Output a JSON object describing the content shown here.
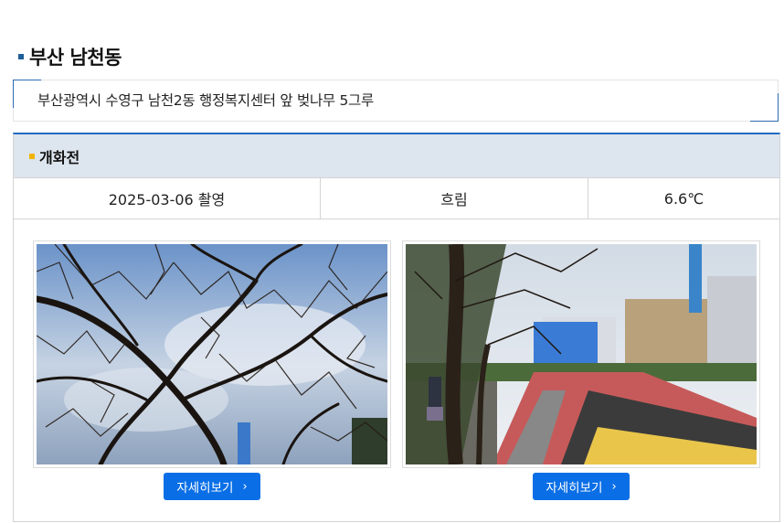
{
  "page": {
    "title": "부산 남천동",
    "address": "부산광역시 수영구 남천2동 행정복지센터 앞 벚나무 5그루"
  },
  "section": {
    "heading": "개화전",
    "date_taken": "2025-03-06 촬영",
    "weather": "흐림",
    "temperature": "6.6℃"
  },
  "photos": [
    {
      "button_label": "자세히보기",
      "button_icon": "chevron-right-icon"
    },
    {
      "button_label": "자세히보기",
      "button_icon": "chevron-right-icon"
    }
  ],
  "colors": {
    "accent_blue": "#0a6fe6",
    "section_border": "#1f6cc2",
    "section_header_bg": "#dde5ee",
    "title_marker": "#1f5e99",
    "heading_marker": "#f0b400"
  }
}
